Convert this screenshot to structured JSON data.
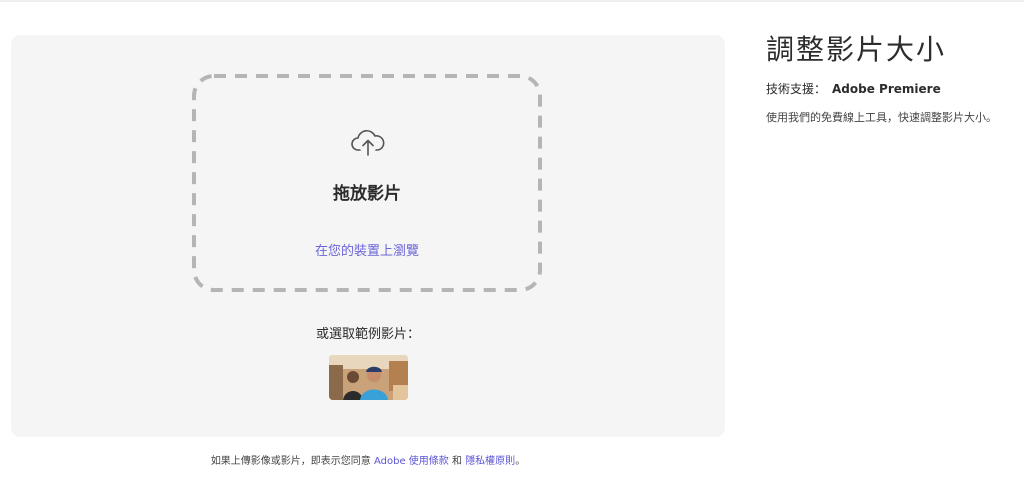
{
  "upload": {
    "drop_title": "拖放影片",
    "browse_link": "在您的裝置上瀏覽",
    "sample_label": "或選取範例影片："
  },
  "footer": {
    "prefix": "如果上傳影像或影片，即表示您同意",
    "terms_link": "Adobe 使用條款",
    "and": "和",
    "privacy_link": "隱私權原則",
    "suffix": "。"
  },
  "sidebar": {
    "title": "調整影片大小",
    "support_label": "技術支援：",
    "support_product": "Adobe Premiere",
    "description": "使用我們的免費線上工具，快速調整影片大小。"
  },
  "icons": {
    "upload": "cloud-upload-icon"
  },
  "colors": {
    "link": "#6b66d9",
    "panel_bg": "#f5f5f5",
    "dash": "#b5b5b5"
  }
}
